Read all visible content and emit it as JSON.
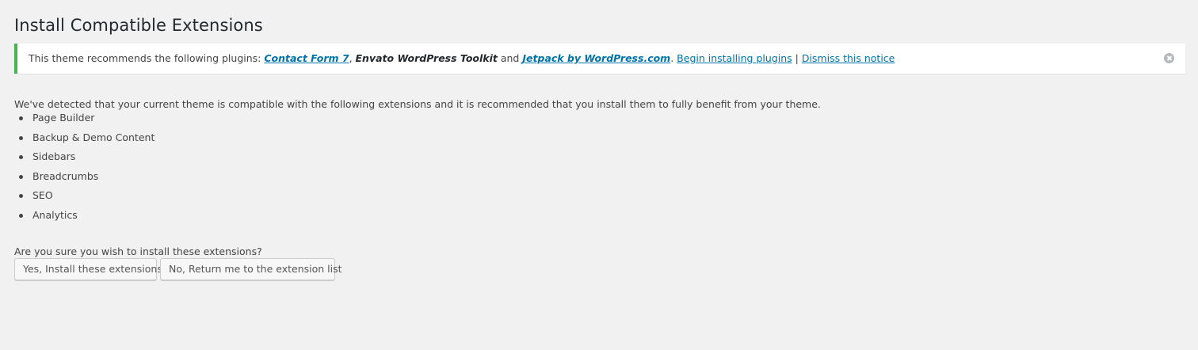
{
  "page": {
    "title": "Install Compatible Extensions"
  },
  "notice": {
    "prefix": "This theme recommends the following plugins: ",
    "plugin_1": "Contact Form 7",
    "sep_1": ", ",
    "plugin_2": "Envato WordPress Toolkit",
    "sep_2": " and ",
    "plugin_3": "Jetpack by WordPress.com",
    "sep_3": ". ",
    "begin_link": "Begin installing plugins",
    "pipe": " | ",
    "dismiss_link": "Dismiss this notice",
    "border_color": "#46b450",
    "icon": "dismiss-circle-icon"
  },
  "intro": "We've detected that your current theme is compatible with the following extensions and it is recommended that you install them to fully benefit from your theme.",
  "extensions": [
    "Page Builder",
    "Backup & Demo Content",
    "Sidebars",
    "Breadcrumbs",
    "SEO",
    "Analytics"
  ],
  "question": "Are you sure you wish to install these extensions?",
  "buttons": {
    "yes": "Yes, Install these extensions",
    "no": "No, Return me to the extension list"
  }
}
